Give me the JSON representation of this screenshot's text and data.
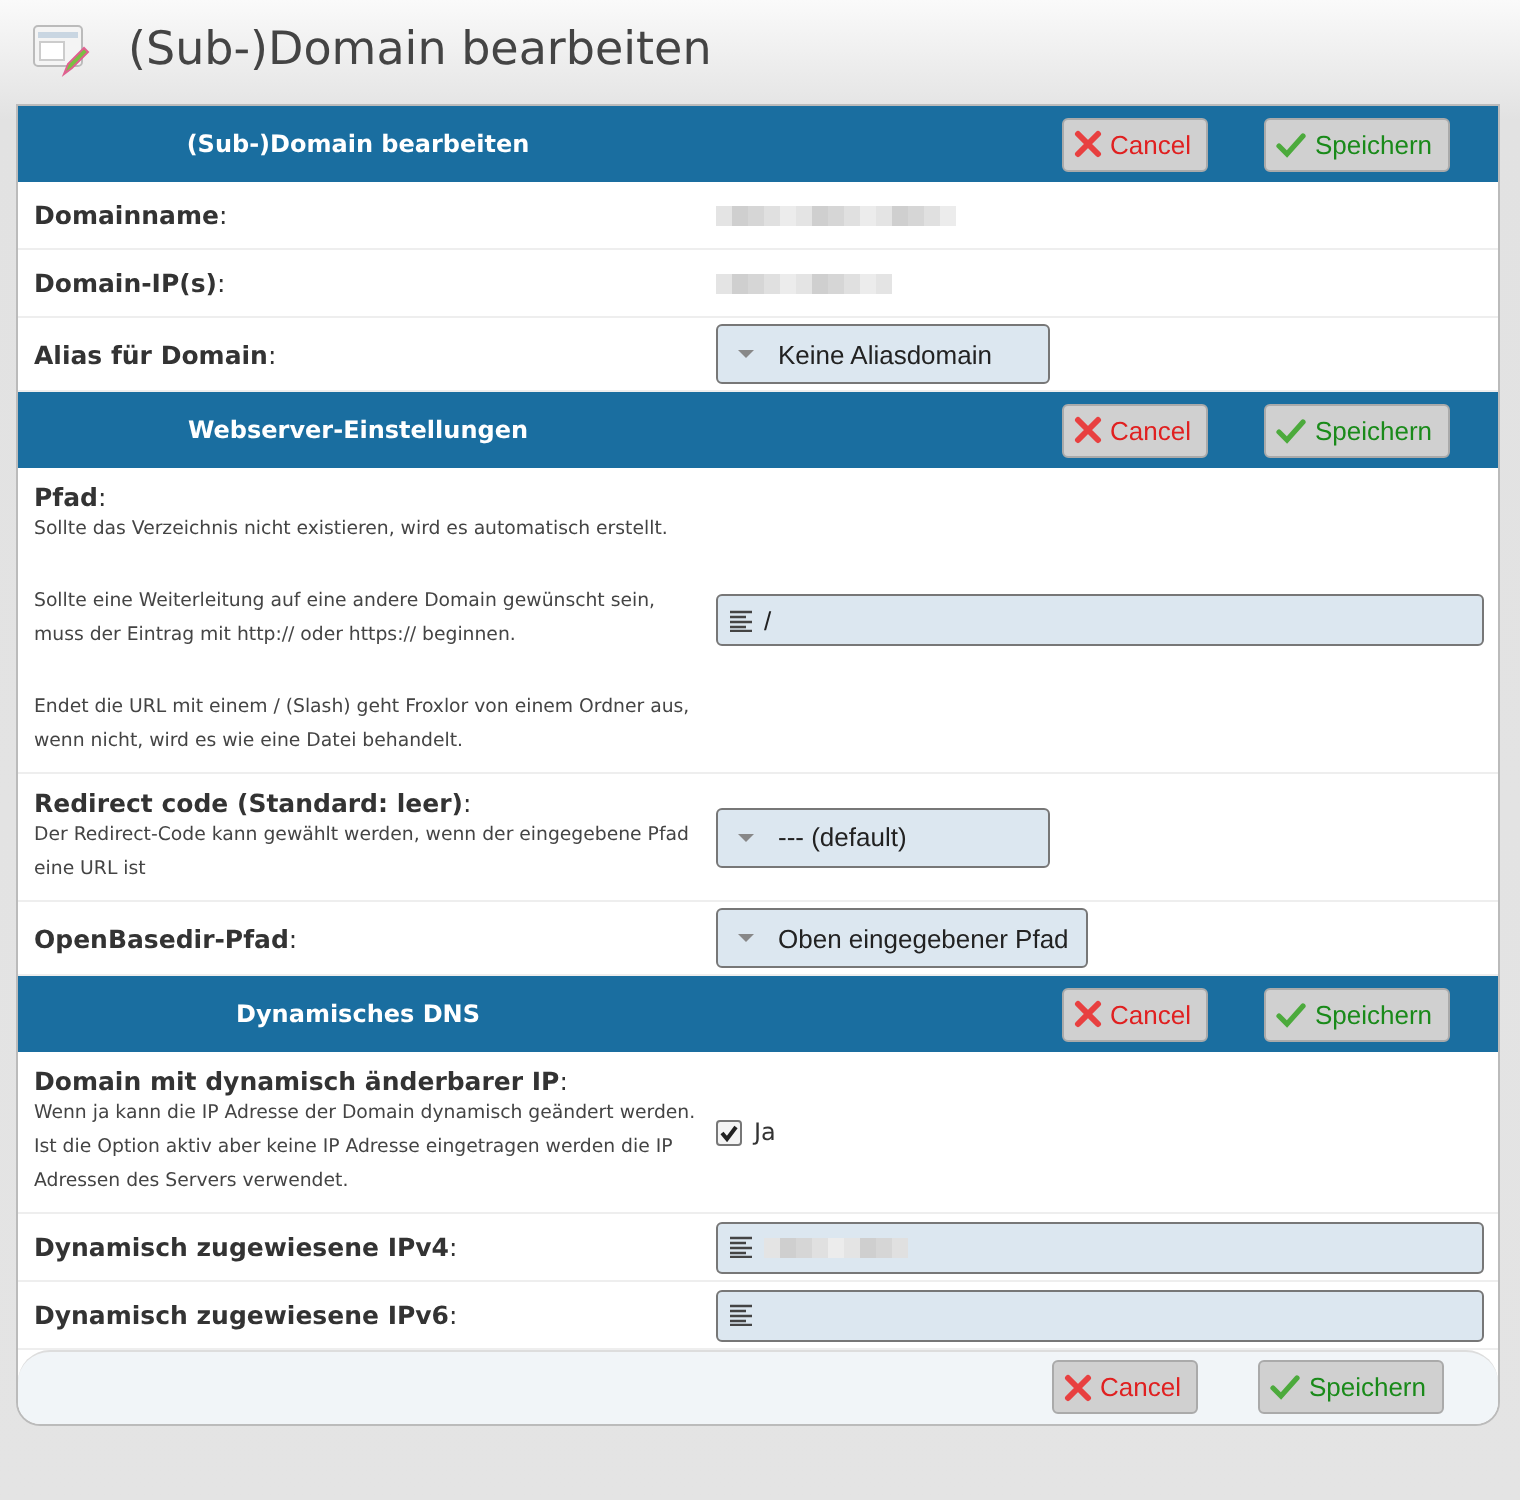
{
  "page_title": "(Sub-)Domain bearbeiten",
  "sections": [
    {
      "title": "(Sub-)Domain bearbeiten",
      "buttons": [
        {
          "kind": "cancel",
          "label": "Cancel"
        },
        {
          "kind": "save",
          "label": "Speichern"
        }
      ],
      "rows": [
        {
          "label": "**Domainname**:",
          "kind": "redacted"
        },
        {
          "label": "**Domain-IP(s)**:",
          "kind": "redacted"
        },
        {
          "label": "**Alias für Domain**:",
          "kind": "select",
          "value": "Keine Aliasdomain"
        }
      ]
    },
    {
      "title": "Webserver-Einstellungen",
      "buttons": [
        {
          "kind": "cancel",
          "label": "Cancel"
        },
        {
          "kind": "save",
          "label": "Speichern"
        }
      ],
      "rows": [
        {
          "label": "**Pfad**:",
          "description": [
            "Sollte das Verzeichnis nicht existieren, wird es automatisch erstellt.",
            "Sollte eine Weiterleitung auf eine andere Domain gewünscht sein, muss der Eintrag mit http:// oder https:// beginnen.",
            "Endet die URL mit einem / (Slash) geht Froxlor von einem Ordner aus, wenn nicht, wird es wie eine Datei behandelt."
          ],
          "kind": "input",
          "value": "/"
        },
        {
          "label": "**Redirect code (Standard: leer)**:",
          "description": [
            "Der Redirect-Code kann gewählt werden, wenn der eingegebene Pfad eine URL ist"
          ],
          "kind": "select",
          "value": "--- (default)"
        },
        {
          "label": "**OpenBasedir-Pfad**:",
          "kind": "select",
          "value": "Oben eingegebener Pfad"
        }
      ]
    },
    {
      "title": "Dynamisches DNS",
      "buttons": [
        {
          "kind": "cancel",
          "label": "Cancel"
        },
        {
          "kind": "save",
          "label": "Speichern"
        }
      ],
      "rows": [
        {
          "label": "**Domain mit dynamisch änderbarer IP**:",
          "description": [
            "Wenn ja kann die IP Adresse der Domain dynamisch geändert werden. Ist die Option aktiv aber keine IP Adresse eingetragen werden die IP Adressen des Servers verwendet."
          ],
          "kind": "checkbox",
          "checked": true,
          "value": "Ja"
        },
        {
          "label": "**Dynamisch zugewiesene IPv4**:",
          "kind": "input",
          "redacted": true
        },
        {
          "label": "**Dynamisch zugewiesene IPv6**:",
          "kind": "input"
        }
      ]
    }
  ],
  "footer_buttons": [
    {
      "kind": "cancel",
      "label": "Cancel"
    },
    {
      "kind": "save",
      "label": "Speichern"
    }
  ]
}
